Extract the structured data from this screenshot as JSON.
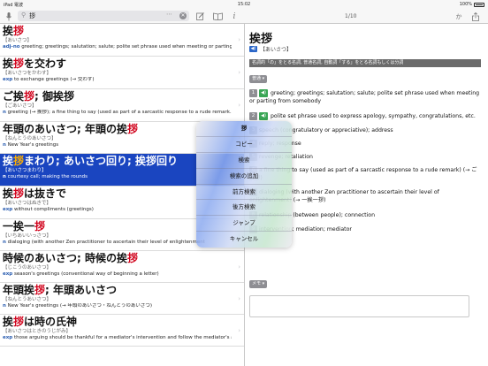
{
  "status_bar": {
    "left": "iPad 電波",
    "time": "15:02",
    "battery": "100%"
  },
  "toolbar": {
    "search_query": "拶",
    "page_counter": "1/10",
    "kana_label": "か"
  },
  "results": [
    {
      "head_parts": [
        "挨",
        "拶",
        ""
      ],
      "reading": "【あいさつ】",
      "pos": "adj-no",
      "def": " greeting; greetings; salutation; salute; polite set phrase used when meeting or parting f…",
      "selected": false
    },
    {
      "head_parts": [
        "挨",
        "拶",
        "を交わす"
      ],
      "reading": "【あいさつをかわす】",
      "pos": "exp",
      "def": " to exchange greetings (→ 交わす)",
      "selected": false
    },
    {
      "head_parts": [
        "ご挨",
        "拶",
        "; 御挨拶"
      ],
      "reading": "【ごあいさつ】",
      "pos": "n",
      "def": " greeting (→ 挨拶); a fine thing to say (used as part of a sarcastic response to a rude remark…",
      "selected": false
    },
    {
      "head_parts": [
        "年頭のあいさつ; 年頭の挨",
        "拶",
        ""
      ],
      "reading": "【ねんとうのあいさつ】",
      "pos": "n",
      "def": " New Year's greetings",
      "selected": false
    },
    {
      "head_parts": [
        "挨",
        "拶",
        "まわり; あいさつ回り; 挨拶回り"
      ],
      "reading": "【あいさつまわり】",
      "pos": "n",
      "def": " courtesy call; making the rounds",
      "selected": true
    },
    {
      "head_parts": [
        "挨",
        "拶",
        "は抜きで"
      ],
      "reading": "【あいさつはぬきで】",
      "pos": "exp",
      "def": " without compliments (greetings)",
      "selected": false
    },
    {
      "head_parts": [
        "一挨一",
        "拶",
        ""
      ],
      "reading": "【いちあいいっさつ】",
      "pos": "n",
      "def": " dialoging (with another Zen practitioner to ascertain their level of enlightenment",
      "selected": false
    },
    {
      "head_parts": [
        "時候のあいさつ; 時候の挨",
        "拶",
        ""
      ],
      "reading": "【じこうのあいさつ】",
      "pos": "exp",
      "def": " season's greetings (conventional way of beginning a letter)",
      "selected": false
    },
    {
      "head_parts": [
        "年頭挨",
        "拶",
        "; 年頭あいさつ"
      ],
      "reading": "【ねんとうあいさつ】",
      "pos": "n",
      "def": " New Year's greetings (→ 年頭のあいさつ・ねんとうのあいさつ)",
      "selected": false
    },
    {
      "head_parts": [
        "挨",
        "拶",
        "は時の氏神"
      ],
      "reading": "【あいさつはときのうじがみ】",
      "pos": "exp",
      "def": " those arguing should be thankful for a mediator's intervention and follow the mediator's a…",
      "selected": false
    }
  ],
  "detail": {
    "headword": "挨拶",
    "reading": "【あいさつ】",
    "grammar": "名詞的「の」をとる名詞, 普通名詞, 自動詞「する」をとる名詞もしくは分詞",
    "field_tag": "普通 ▾",
    "senses": [
      {
        "num": "1",
        "text": "greeting; greetings; salutation; salute; polite set phrase used when meeting or parting from somebody"
      },
      {
        "num": "2",
        "text": "polite set phrase used to express apology, sympathy, congratulations, etc."
      },
      {
        "num": "3",
        "text": "speech (congratulatory or appreciative); address"
      },
      {
        "num": "4",
        "text": "reply; response"
      },
      {
        "num": "5",
        "text": "revenge; retaliation"
      },
      {
        "num": "6",
        "text": "a fine thing to say (used as part of a sarcastic response to a rude remark) (→ ご挨拶)"
      },
      {
        "num": "7",
        "text": "dialoging (with another Zen practitioner to ascertain their level of enlightenment) (→ 一挨一拶)"
      },
      {
        "num": "8",
        "text": "relationship (between people); connection"
      },
      {
        "num": "9",
        "text": "intervention; mediation; mediator"
      }
    ],
    "memo_tag": "メモ ▾"
  },
  "popup": {
    "title": "拶",
    "items": [
      "コピー",
      "検索",
      "検索の追加",
      "前方検索",
      "後方検索",
      "ジャンプ",
      "キャンセル"
    ]
  }
}
